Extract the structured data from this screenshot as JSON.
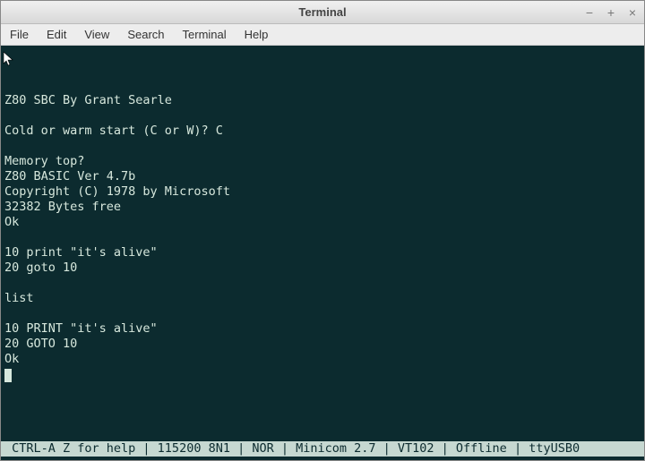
{
  "window": {
    "title": "Terminal"
  },
  "menubar": {
    "items": [
      "File",
      "Edit",
      "View",
      "Search",
      "Terminal",
      "Help"
    ]
  },
  "terminal": {
    "lines": [
      "Z80 SBC By Grant Searle",
      "",
      "Cold or warm start (C or W)? C",
      "",
      "Memory top?",
      "Z80 BASIC Ver 4.7b",
      "Copyright (C) 1978 by Microsoft",
      "32382 Bytes free",
      "Ok",
      "",
      "10 print \"it's alive\"",
      "20 goto 10",
      "",
      "list",
      "",
      "10 PRINT \"it's alive\"",
      "20 GOTO 10",
      "Ok"
    ],
    "statusbar": " CTRL-A Z for help | 115200 8N1 | NOR | Minicom 2.7 | VT102 | Offline | ttyUSB0 "
  }
}
